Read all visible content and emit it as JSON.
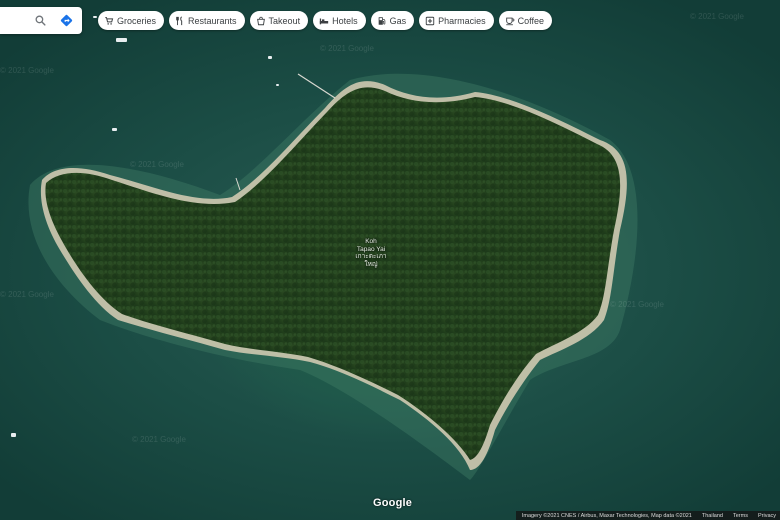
{
  "search": {
    "search_icon": "search-icon",
    "directions_icon": "directions-icon"
  },
  "chips": [
    {
      "label": "Groceries",
      "icon": "cart-icon"
    },
    {
      "label": "Restaurants",
      "icon": "fork-knife-icon"
    },
    {
      "label": "Takeout",
      "icon": "takeout-icon"
    },
    {
      "label": "Hotels",
      "icon": "bed-icon"
    },
    {
      "label": "Gas",
      "icon": "gas-pump-icon"
    },
    {
      "label": "Pharmacies",
      "icon": "pharmacy-icon"
    },
    {
      "label": "Coffee",
      "icon": "coffee-icon"
    }
  ],
  "map": {
    "place_name_line1": "Koh",
    "place_name_line2": "Tapao Yai",
    "place_name_thai_line1": "เกาะตะเภา",
    "place_name_thai_line2": "ใหญ่",
    "watermark": "© 2021 Google",
    "logo": "Google"
  },
  "footer": {
    "imagery": "Imagery ©2021 CNES / Airbus, Maxar Technologies, Map data ©2021",
    "country": "Thailand",
    "terms": "Terms",
    "privacy": "Privacy"
  },
  "colors": {
    "water_deep": "#0f3a34",
    "water_shallow": "#2e6b56",
    "forest": "#24431f",
    "beach": "#d9d1b8"
  }
}
